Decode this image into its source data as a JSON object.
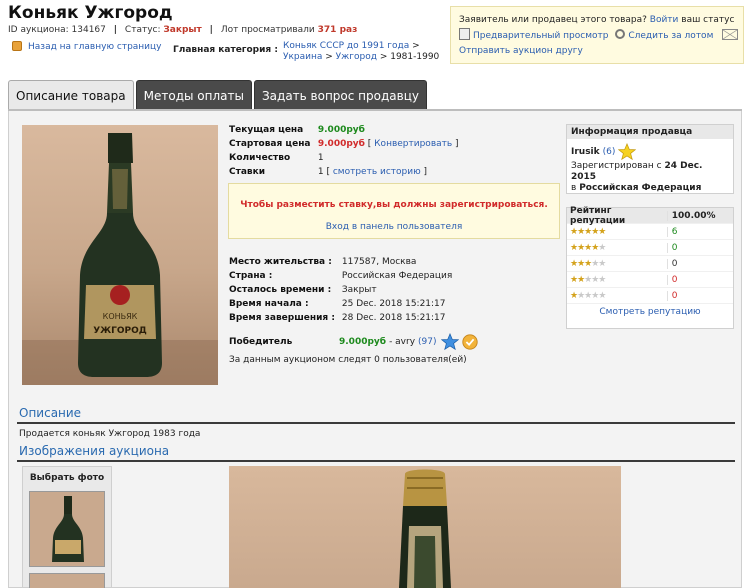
{
  "header": {
    "title": "Коньяк Ужгород",
    "auction_id_label": "ID аукциона:",
    "auction_id": "134167",
    "status_label": "Статус:",
    "status_value": "Закрыт",
    "views_label": "Лот просматривали",
    "views_count": "371 раз",
    "back_link": "Назад на главную страницу",
    "category_label": "Главная категория :",
    "category_path": [
      "Коньяк СССР до 1991 года",
      "Украина",
      "Ужгород",
      "1981-1990"
    ]
  },
  "notice": {
    "text": "Заявитель или продавец этого товара?",
    "login_link": "Войти",
    "text_end": "ваш статус",
    "preview_link": "Предварительный просмотр",
    "watch_link": "Следить за лотом",
    "send_link": "Отправить аукцион другу"
  },
  "tabs": [
    {
      "label": "Описание товара",
      "active": true
    },
    {
      "label": "Методы оплаты",
      "active": false
    },
    {
      "label": "Задать вопрос продавцу",
      "active": false
    }
  ],
  "product": {
    "current_price_label": "Текущая цена",
    "current_price": "9.000руб",
    "start_price_label": "Стартовая цена",
    "start_price": "9.000руб",
    "convert_link": "Конвертировать",
    "qty_label": "Количество",
    "qty": "1",
    "bids_label": "Ставки",
    "bids": "1",
    "history_link": "смотреть историю",
    "register_msg": "Чтобы разместить ставку,вы должны зарегистрироваться.",
    "panel_link": "Вход в панель пользователя",
    "location_label": "Место жительства :",
    "location": "117587, Москва",
    "country_label": "Страна :",
    "country": "Российская Федерация",
    "time_left_label": "Осталось времени :",
    "time_left": "Закрыт",
    "start_label": "Время начала :",
    "start": "25 Dec. 2018 15:21:17",
    "end_label": "Время завершения :",
    "end": "28 Dec. 2018 15:21:17",
    "winner_label": "Победитель",
    "winner_price": "9.000руб",
    "winner_name": "- avry",
    "winner_rating": "(97)",
    "watchers": "За данным аукционом следят 0 пользователя(ей)",
    "bottle_label_1": "КОНЬЯК",
    "bottle_label_2": "УЖГОРОД"
  },
  "seller": {
    "title": "Информация продавца",
    "name": "Irusik",
    "rating": "(6)",
    "registered_label": "Зарегистрирован с",
    "registered_date": "24 Dec. 2015",
    "country_prefix": "в",
    "country": "Российская Федерация"
  },
  "reputation": {
    "header_label": "Рейтинг репутации",
    "header_value": "100.00%",
    "rows": [
      {
        "stars": 5,
        "count": "6",
        "color": "#1d8a1d"
      },
      {
        "stars": 4,
        "count": "0",
        "color": "#1d8a1d"
      },
      {
        "stars": 3,
        "count": "0",
        "color": "#333333"
      },
      {
        "stars": 2,
        "count": "0",
        "color": "#d12b2b"
      },
      {
        "stars": 1,
        "count": "0",
        "color": "#d12b2b"
      }
    ],
    "view_link": "Смотреть репутацию"
  },
  "description": {
    "heading": "Описание",
    "text": "Продается коньяк Ужгород 1983 года"
  },
  "images": {
    "heading": "Изображения аукциона",
    "choose_label": "Выбрать фото"
  }
}
